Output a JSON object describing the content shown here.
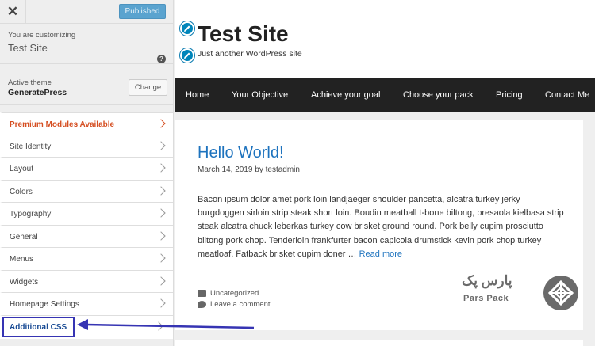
{
  "sidebar": {
    "close_glyph": "✕",
    "published_label": "Published",
    "customizing_label": "You are customizing",
    "customizing_site": "Test Site",
    "help_glyph": "?",
    "theme_label": "Active theme",
    "theme_name": "GeneratePress",
    "change_label": "Change",
    "items": [
      {
        "label": "Premium Modules Available"
      },
      {
        "label": "Site Identity"
      },
      {
        "label": "Layout"
      },
      {
        "label": "Colors"
      },
      {
        "label": "Typography"
      },
      {
        "label": "General"
      },
      {
        "label": "Menus"
      },
      {
        "label": "Widgets"
      },
      {
        "label": "Homepage Settings"
      },
      {
        "label": "Additional CSS"
      }
    ]
  },
  "preview": {
    "site_title": "Test Site",
    "tagline": "Just another WordPress site",
    "nav": [
      "Home",
      "Your Objective",
      "Achieve your goal",
      "Choose your pack",
      "Pricing",
      "Contact Me"
    ],
    "post": {
      "title": "Hello World!",
      "meta": "March 14, 2019 by testadmin",
      "body": "Bacon ipsum dolor amet pork loin landjaeger shoulder pancetta, alcatra turkey jerky burgdoggen sirloin strip steak short loin. Boudin meatball t-bone biltong, bresaola kielbasa strip steak alcatra chuck leberkas turkey cow brisket ground round. Pork belly cupim prosciutto biltong pork chop. Tenderloin frankfurter bacon capicola drumstick kevin pork chop turkey meatloaf. Fatback brisket cupim doner … ",
      "read_more": "Read more",
      "category": "Uncategorized",
      "comment": "Leave a comment"
    },
    "watermark_fa": "پارس پک",
    "watermark_en": "Pars Pack"
  },
  "colors": {
    "accent": "#0085ba",
    "link": "#1e73be",
    "premium": "#d54e21",
    "highlight": "#3634b3",
    "nav_bg": "#222222"
  },
  "icons": {
    "close": "close-icon",
    "help": "help-icon",
    "edit": "pencil-icon",
    "chevron": "chevron-right-icon",
    "category": "folder-icon",
    "comment": "comment-icon",
    "logo": "parspack-logo-icon",
    "arrow": "arrow-left-icon"
  }
}
